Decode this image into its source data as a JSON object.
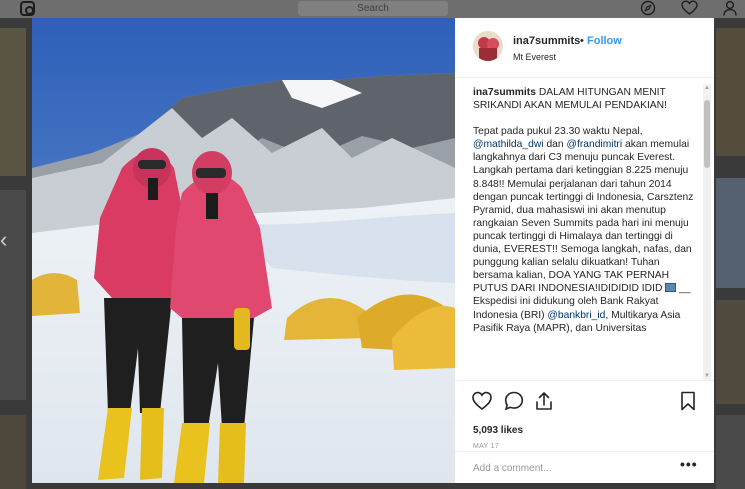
{
  "topbar": {
    "logo_icon": "instagram-logo",
    "search_placeholder": "Search",
    "icons": [
      "compass-icon",
      "heart-icon",
      "profile-icon"
    ]
  },
  "post": {
    "username": "ina7summits",
    "separator": "•",
    "follow_label": "Follow",
    "location": "Mt Everest",
    "caption": {
      "author": "ina7summits",
      "headline": "DALAM HITUNGAN MENIT SRIKANDI AKAN MEMULAI PENDAKIAN!",
      "p2_a": "Tepat pada pukul 23.30 waktu Nepal,",
      "mention1": "@mathilda_dwi",
      "p2_b": "dan",
      "mention2": "@frandimitri",
      "p2_c": "akan memulai langkahnya dari C3 menuju puncak Everest. Langkah pertama dari ketinggian 8.225 menuju 8.848!! Memulai perjalanan dari tahun 2014 dengan puncak tertinggi di Indonesia, Carsztenz Pyramid, dua mahasiswi ini akan menutup rangkaian Seven Summits pada hari ini menuju puncak tertinggi di Himalaya dan tertinggi di dunia, EVEREST!! Semoga langkah, nafas, dan punggung kalian selalu dikuatkan! Tuhan bersama kalian, DOA YANG TAK PERNAH PUTUS DARI INDONESIA!",
      "flags_text": "IDIDIDID IDID",
      "flags_tail": "__",
      "p3_a": "Ekspedisi ini didukung oleh Bank Rakyat Indonesia (BRI)",
      "mention3": "@bankbri_id",
      "p3_b": ", Multikarya Asia Pasifik Raya (MAPR), dan Universitas"
    },
    "likes": "5,093 likes",
    "date": "MAY 17",
    "comment_placeholder": "Add a comment...",
    "more_label": "•••"
  },
  "colors": {
    "link_blue": "#3897f0",
    "text": "#262626",
    "muted": "#999999"
  }
}
